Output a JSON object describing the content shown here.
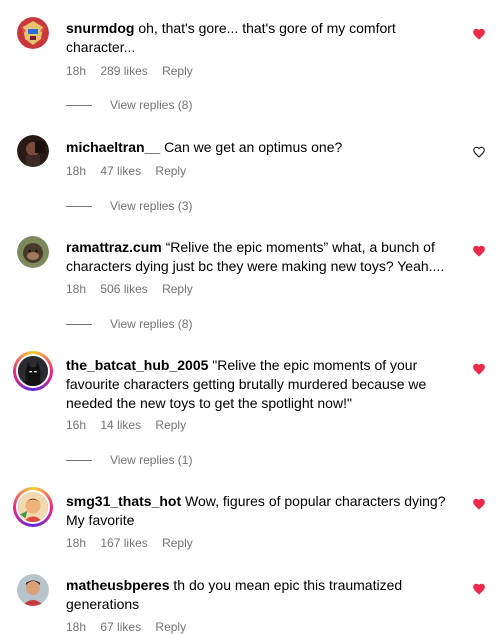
{
  "colors": {
    "heart_liked": "#ed2a4b",
    "meta": "#737373"
  },
  "comments": [
    {
      "username": "snurmdog",
      "text": "oh, that's gore... that's gore of my comfort character...",
      "time": "18h",
      "likes": "289 likes",
      "reply": "Reply",
      "replies": "View replies (8)",
      "liked": true,
      "avatar_icon": "robot-avatar"
    },
    {
      "username": "michaeltran__",
      "text": "Can we get an optimus one?",
      "time": "18h",
      "likes": "47 likes",
      "reply": "Reply",
      "replies": "View replies (3)",
      "liked": false,
      "avatar_icon": "person-avatar"
    },
    {
      "username": "ramattraz.cum",
      "text": "“Relive the epic moments” what, a bunch of characters dying just bc they were making new toys? Yeah....",
      "time": "18h",
      "likes": "506 likes",
      "reply": "Reply",
      "replies": "View replies (8)",
      "liked": true,
      "avatar_icon": "monkey-avatar"
    },
    {
      "username": "the_batcat_hub_2005",
      "text": "\"Relive the epic moments of your favourite characters getting brutally murdered because we needed the new toys to get the spotlight now!\"",
      "time": "16h",
      "likes": "14 likes",
      "reply": "Reply",
      "replies": "View replies (1)",
      "liked": true,
      "avatar_icon": "batman-avatar"
    },
    {
      "username": "smg31_thats_hot",
      "text": "Wow, figures of popular characters dying? My favorite",
      "time": "18h",
      "likes": "167 likes",
      "reply": "Reply",
      "replies": "",
      "liked": true,
      "avatar_icon": "cartoon-avatar"
    },
    {
      "username": "matheusbperes",
      "text": "th do you mean epic this traumatized generations",
      "time": "18h",
      "likes": "67 likes",
      "reply": "Reply",
      "replies": "",
      "liked": true,
      "avatar_icon": "person-avatar"
    }
  ]
}
